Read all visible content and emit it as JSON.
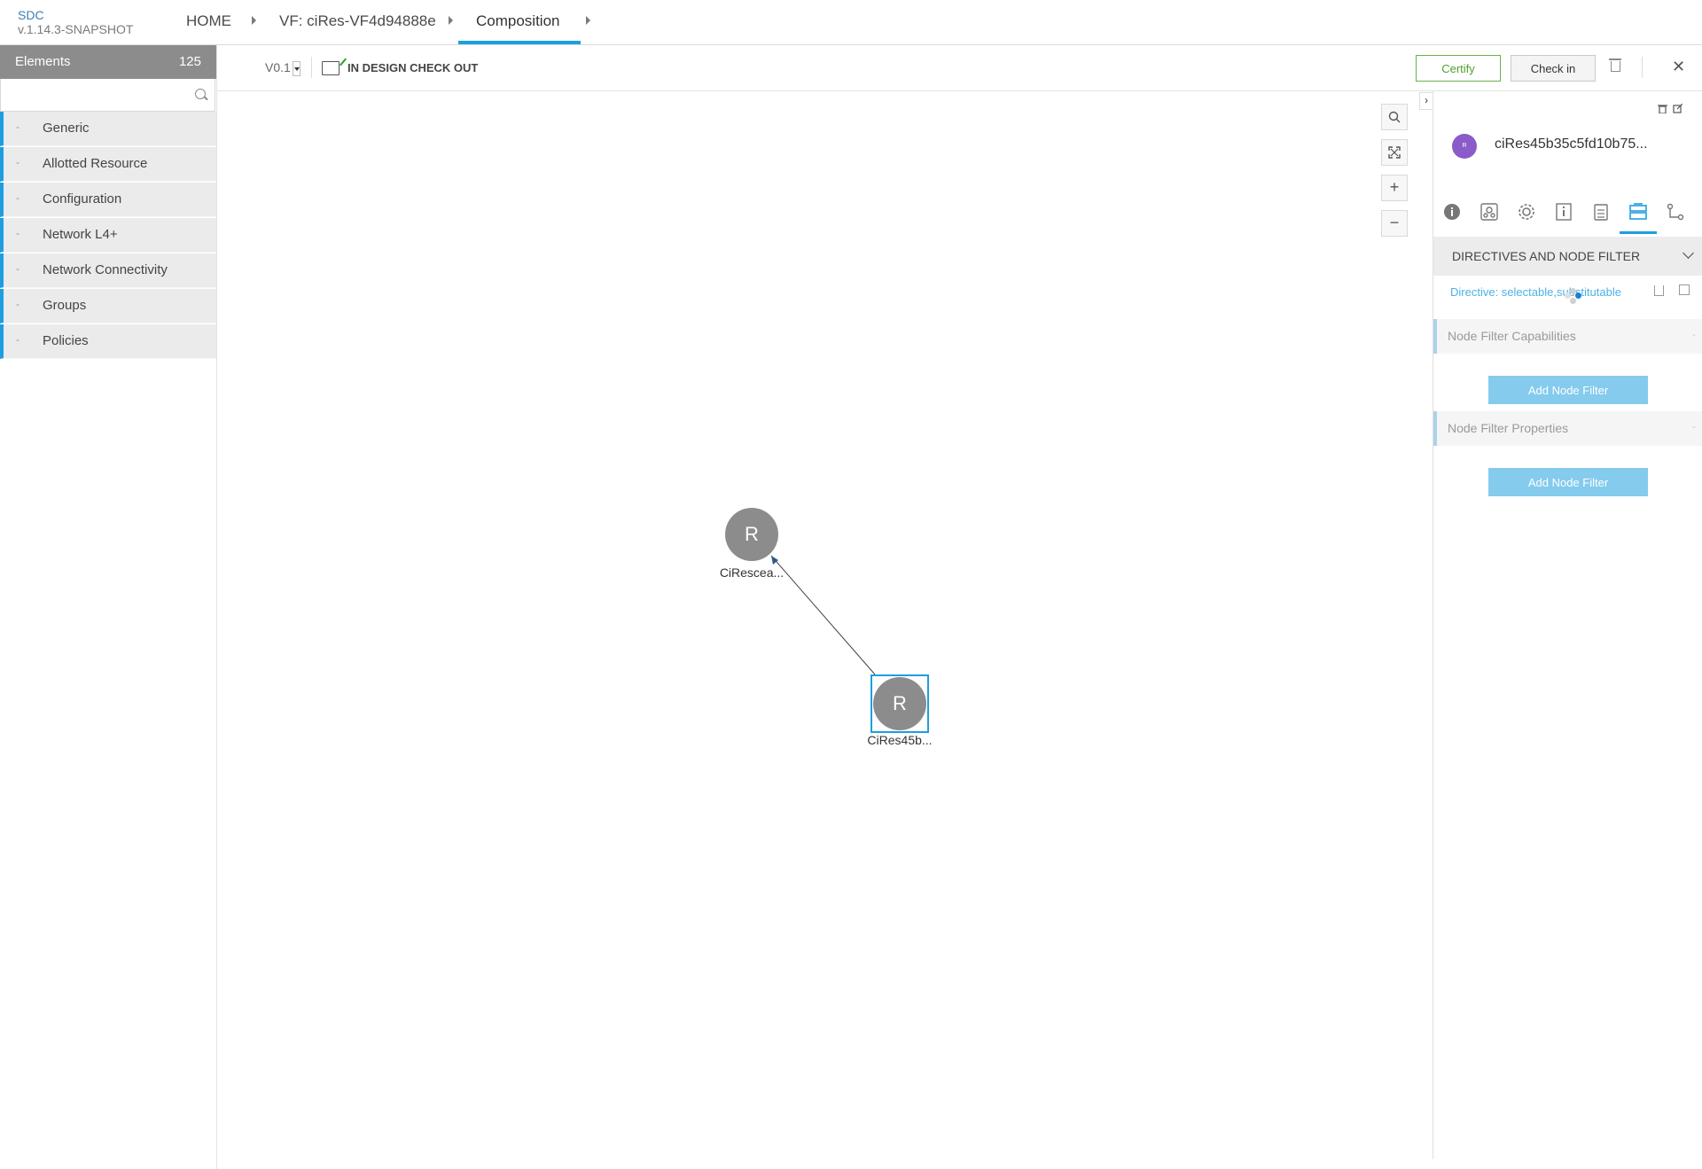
{
  "app": {
    "name": "SDC",
    "version": "v.1.14.3-SNAPSHOT"
  },
  "breadcrumbs": [
    {
      "label": "HOME"
    },
    {
      "label": "VF: ciRes-VF4d94888e"
    },
    {
      "label": "Composition"
    }
  ],
  "palette": {
    "title": "Elements",
    "count": "125",
    "search": {
      "value": "",
      "placeholder": ""
    },
    "categories": [
      {
        "label": "Generic"
      },
      {
        "label": "Allotted Resource"
      },
      {
        "label": "Configuration"
      },
      {
        "label": "Network L4+"
      },
      {
        "label": "Network Connectivity"
      },
      {
        "label": "Groups"
      },
      {
        "label": "Policies"
      }
    ]
  },
  "toolbar": {
    "version": "V0.1",
    "status": "IN DESIGN CHECK OUT",
    "certify_label": "Certify",
    "checkin_label": "Check in",
    "close_symbol": "✕"
  },
  "canvas": {
    "zoom_controls": [
      "search-icon",
      "fit-icon",
      "zoom-in-icon",
      "zoom-out-icon"
    ],
    "nodes": [
      {
        "letter": "R",
        "label": "CiRescea..."
      },
      {
        "letter": "R",
        "label": "CiRes45b...",
        "selected": true
      }
    ]
  },
  "right_panel": {
    "avatar_letter": "R",
    "avatar_color": "#8a5bc9",
    "title": "ciRes45b35c5fd10b75...",
    "tabs": [
      "info-icon",
      "composition-icon",
      "settings-icon",
      "details-icon",
      "clipboard-icon",
      "directives-icon",
      "relations-icon"
    ],
    "active_tab": 5,
    "section_title": "DIRECTIVES AND NODE FILTER",
    "directive": "Directive: selectable,substitutable",
    "capabilities_title": "Node Filter Capabilities",
    "properties_title": "Node Filter Properties",
    "add_filter_label": "Add Node Filter",
    "accent_color": "#1e9ee0"
  }
}
